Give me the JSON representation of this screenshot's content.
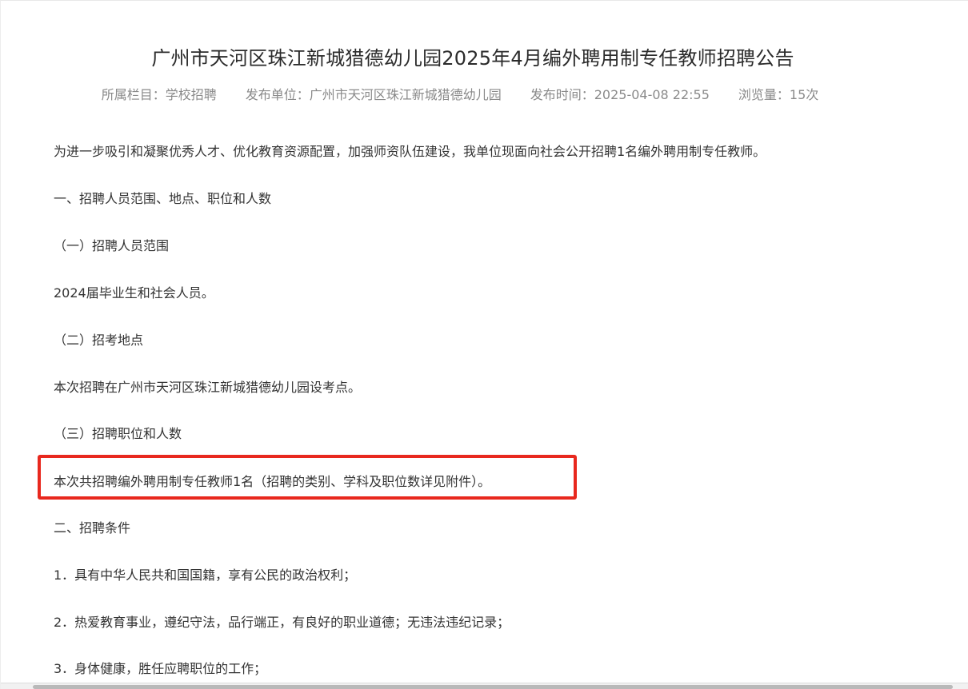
{
  "article": {
    "title": "广州市天河区珠江新城猎德幼儿园2025年4月编外聘用制专任教师招聘公告",
    "meta": {
      "category": "所属栏目：学校招聘",
      "publisher": "发布单位：广州市天河区珠江新城猎德幼儿园",
      "published": "发布时间：2025-04-08 22:55",
      "views": "浏览量：15次"
    },
    "paragraphs": [
      "为进一步吸引和凝聚优秀人才、优化教育资源配置，加强师资队伍建设，我单位现面向社会公开招聘1名编外聘用制专任教师。",
      "一、招聘人员范围、地点、职位和人数",
      "（一）招聘人员范围",
      "2024届毕业生和社会人员。",
      "（二）招考地点",
      "本次招聘在广州市天河区珠江新城猎德幼儿园设考点。",
      "（三）招聘职位和人数",
      "本次共招聘编外聘用制专任教师1名（招聘的类别、学科及职位数详见附件）。",
      "二、招聘条件",
      "1．具有中华人民共和国国籍，享有公民的政治权利；",
      "2．热爱教育事业，遵纪守法，品行端正，有良好的职业道德；无违法违纪记录；",
      "3．身体健康，胜任应聘职位的工作；"
    ]
  },
  "highlight_color": "#e8281e"
}
